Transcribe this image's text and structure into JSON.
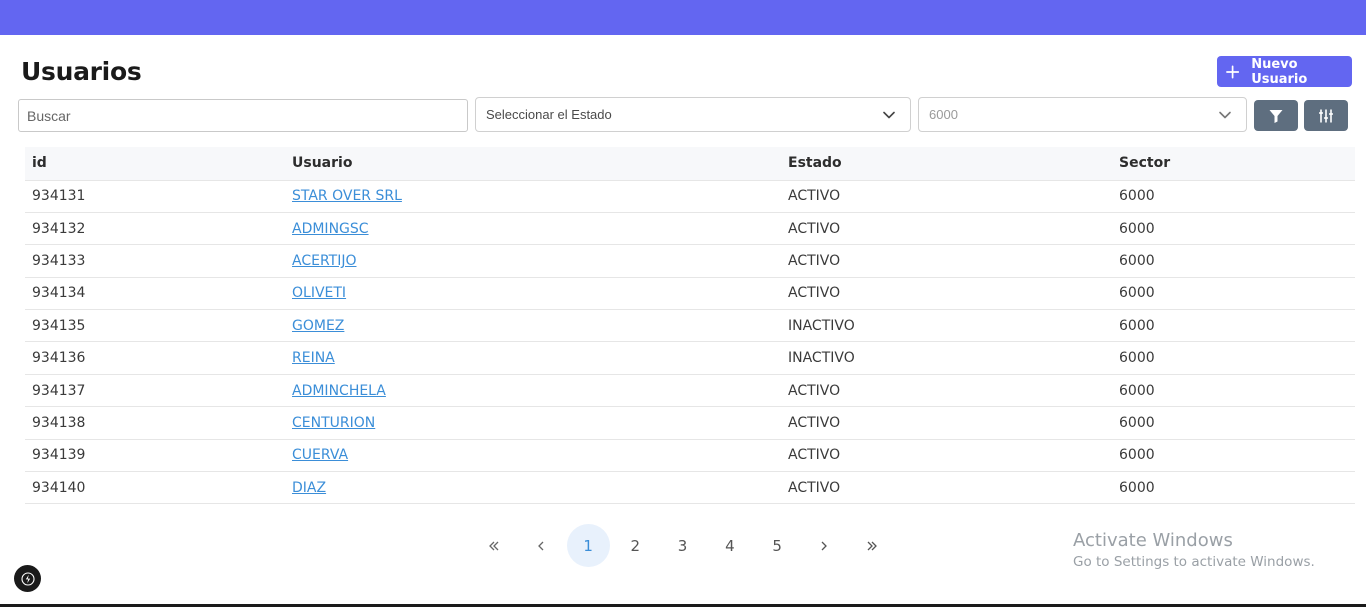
{
  "header": {
    "title": "Usuarios",
    "new_button_label": "Nuevo Usuario"
  },
  "filters": {
    "search_placeholder": "Buscar",
    "estado_placeholder": "Seleccionar el Estado",
    "sector_value": "6000"
  },
  "table": {
    "columns": [
      "id",
      "Usuario",
      "Estado",
      "Sector"
    ],
    "rows": [
      {
        "id": "934131",
        "usuario": "STAR OVER SRL",
        "estado": "ACTIVO",
        "sector": "6000"
      },
      {
        "id": "934132",
        "usuario": "ADMINGSC",
        "estado": "ACTIVO",
        "sector": "6000"
      },
      {
        "id": "934133",
        "usuario": "ACERTIJO",
        "estado": "ACTIVO",
        "sector": "6000"
      },
      {
        "id": "934134",
        "usuario": "OLIVETI",
        "estado": "ACTIVO",
        "sector": "6000"
      },
      {
        "id": "934135",
        "usuario": "GOMEZ",
        "estado": "INACTIVO",
        "sector": "6000"
      },
      {
        "id": "934136",
        "usuario": "REINA",
        "estado": "INACTIVO",
        "sector": "6000"
      },
      {
        "id": "934137",
        "usuario": "ADMINCHELA",
        "estado": "ACTIVO",
        "sector": "6000"
      },
      {
        "id": "934138",
        "usuario": "CENTURION",
        "estado": "ACTIVO",
        "sector": "6000"
      },
      {
        "id": "934139",
        "usuario": "CUERVA",
        "estado": "ACTIVO",
        "sector": "6000"
      },
      {
        "id": "934140",
        "usuario": "DIAZ",
        "estado": "ACTIVO",
        "sector": "6000"
      }
    ]
  },
  "pagination": {
    "pages": [
      "1",
      "2",
      "3",
      "4",
      "5"
    ],
    "current": "1"
  },
  "watermark": {
    "line1": "Activate Windows",
    "line2": "Go to Settings to activate Windows."
  },
  "colors": {
    "accent": "#6366f1",
    "link": "#3b8ed8",
    "icon_button": "#5e6e7f"
  }
}
